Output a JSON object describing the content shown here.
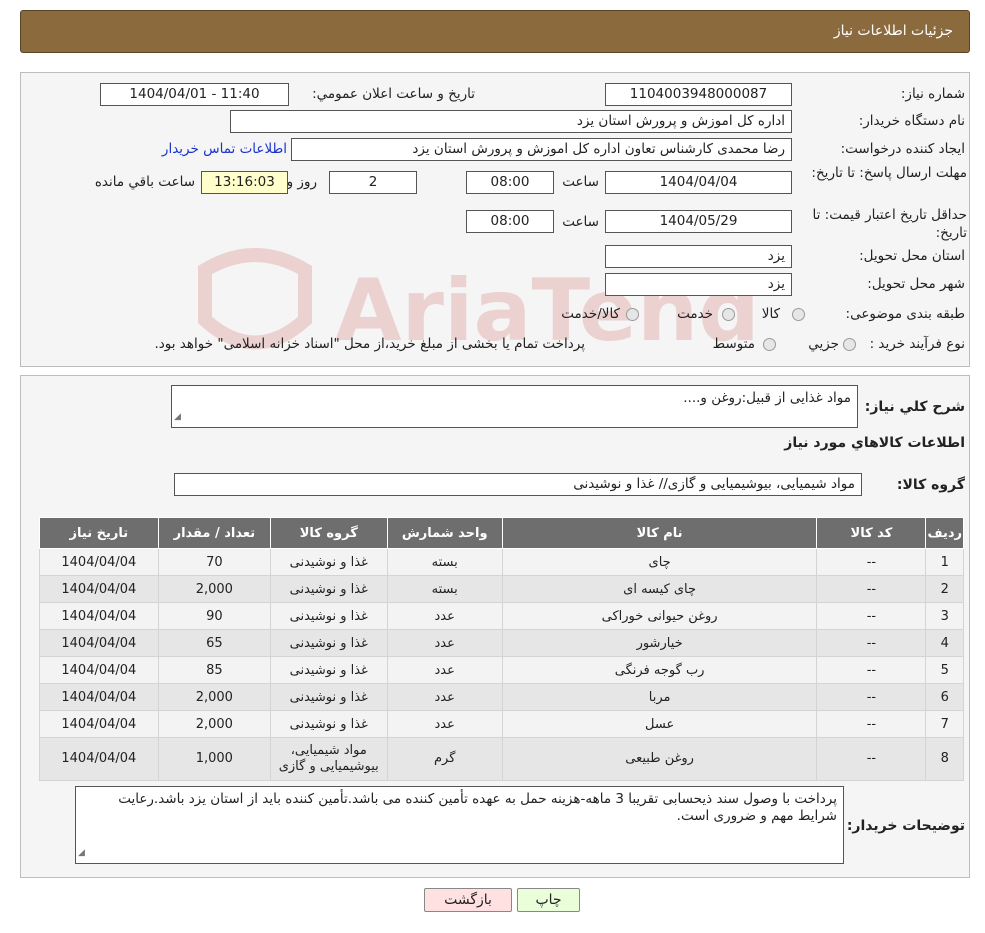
{
  "header": {
    "title": "جزئیات اطلاعات نیاز"
  },
  "form": {
    "need_number_label": "شماره نیاز:",
    "need_number": "1104003948000087",
    "announce_label": "تاریخ و ساعت اعلان عمومي:",
    "announce_value": "1404/04/01 - 11:40",
    "buyer_label": "نام دستگاه خريدار:",
    "buyer_value": "اداره کل اموزش و پرورش استان یزد",
    "requester_label": "ايجاد کننده درخواست:",
    "requester_value": "رضا محمدی کارشناس تعاون اداره کل اموزش و پرورش استان یزد",
    "contact_link": "اطلاعات تماس خريدار",
    "deadline_label": "مهلت ارسال پاسخ: تا تاريخ:",
    "deadline_date": "1404/04/04",
    "time_label": "ساعت",
    "deadline_time": "08:00",
    "days_value": "2",
    "days_label": "روز و",
    "remaining_time": "13:16:03",
    "remaining_label": "ساعت باقي مانده",
    "validity_label": "حداقل تاريخ اعتبار قيمت: تا تاريخ:",
    "validity_date": "1404/05/29",
    "validity_time": "08:00",
    "province_label": "استان محل تحويل:",
    "province_value": "یزد",
    "city_label": "شهر محل تحويل:",
    "city_value": "یزد",
    "category_label": "طبقه بندی موضوعی:",
    "category_options": [
      "کالا",
      "خدمت",
      "کالا/خدمت"
    ],
    "process_label": "نوع فرآيند خريد :",
    "process_options": [
      "جزيي",
      "متوسط"
    ],
    "process_note": "پرداخت تمام یا بخشی از مبلغ خرید،از محل \"اسناد خزانه اسلامی\" خواهد بود."
  },
  "details": {
    "summary_label": "شرح کلي نياز:",
    "summary_value": "مواد غذایی از قبیل:روغن و....",
    "goods_title": "اطلاعات کالاهاي مورد نياز",
    "group_label": "گروه کالا:",
    "group_value": "مواد شیمیایی، بیوشیمیایی و  گازی// غذا و نوشیدنی",
    "table": {
      "headers": [
        "رديف",
        "کد کالا",
        "نام کالا",
        "واحد شمارش",
        "گروه کالا",
        "تعداد / مقدار",
        "تاريخ نياز"
      ],
      "rows": [
        [
          "1",
          "--",
          "چای",
          "بسته",
          "غذا و نوشیدنی",
          "70",
          "1404/04/04"
        ],
        [
          "2",
          "--",
          "چای کیسه ای",
          "بسته",
          "غذا و نوشیدنی",
          "2,000",
          "1404/04/04"
        ],
        [
          "3",
          "--",
          "روغن حیوانی خوراکی",
          "عدد",
          "غذا و نوشیدنی",
          "90",
          "1404/04/04"
        ],
        [
          "4",
          "--",
          "خیارشور",
          "عدد",
          "غذا و نوشیدنی",
          "65",
          "1404/04/04"
        ],
        [
          "5",
          "--",
          "رب گوجه فرنگی",
          "عدد",
          "غذا و نوشیدنی",
          "85",
          "1404/04/04"
        ],
        [
          "6",
          "--",
          "مربا",
          "عدد",
          "غذا و نوشیدنی",
          "2,000",
          "1404/04/04"
        ],
        [
          "7",
          "--",
          "عسل",
          "عدد",
          "غذا و نوشیدنی",
          "2,000",
          "1404/04/04"
        ],
        [
          "8",
          "--",
          "روغن طبیعی",
          "گرم",
          "مواد شیمیایی، بیوشیمیایی و گازی",
          "1,000",
          "1404/04/04"
        ]
      ]
    },
    "buyer_notes_label": "توضيحات خريدار:",
    "buyer_notes": "پرداخت با وصول سند ذیحسابی تقریبا 3 ماهه-هزینه حمل به عهده تأمین کننده می باشد.تأمین کننده باید از استان یزد باشد.رعایت شرایط مهم و ضروری است."
  },
  "buttons": {
    "print": "چاپ",
    "back": "بازگشت"
  },
  "watermark": {
    "text": "AriaTender.neT"
  },
  "colors": {
    "header_bg": "#8b6a3d",
    "table_header_bg": "#6e6e6e",
    "print_btn": "#eaffd9",
    "back_btn": "#ffe1e1"
  }
}
